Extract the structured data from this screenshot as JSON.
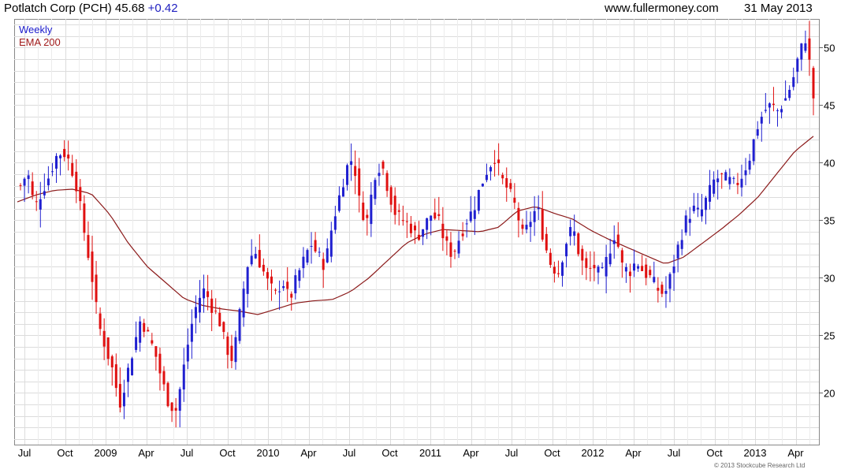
{
  "header": {
    "title": "Potlatch Corp (PCH) 45.68",
    "change": "+0.42",
    "site": "www.fullermoney.com",
    "date": "31 May 2013"
  },
  "legend": {
    "period": "Weekly",
    "ema": "EMA 200"
  },
  "copyright": "© 2013 Stockcube Research Ltd",
  "colors": {
    "up": "#2020d0",
    "down": "#e01010",
    "ema": "#8b1a1a",
    "grid": "#dcdcdc"
  },
  "chart_data": {
    "type": "candlestick",
    "title": "Potlatch Corp (PCH) 45.68 +0.42",
    "x_axis": {
      "tick_labels": [
        "Jul",
        "Oct",
        "2009",
        "Apr",
        "Jul",
        "Oct",
        "2010",
        "Apr",
        "Jul",
        "Oct",
        "2011",
        "Apr",
        "Jul",
        "Oct",
        "2012",
        "Apr",
        "Jul",
        "Oct",
        "2013",
        "Apr"
      ]
    },
    "y_axis": {
      "position": "right",
      "range": [
        15.5,
        52.5
      ],
      "ticks": [
        20,
        25,
        30,
        35,
        40,
        45,
        50
      ]
    },
    "grid": true,
    "legend": "top-left",
    "series": [
      {
        "name": "Weekly",
        "kind": "ohlc",
        "close_path": [
          38,
          39.2,
          36,
          37.5,
          38.8,
          40.5,
          41,
          40,
          37.8,
          34,
          30.5,
          26,
          24,
          22,
          19,
          21.5,
          24,
          26.5,
          25,
          23.5,
          21,
          19,
          18.5,
          22,
          25.5,
          28,
          29,
          27.5,
          26.5,
          24,
          22.8,
          27,
          31,
          32.5,
          31,
          29.5,
          28.5,
          29.8,
          28,
          30,
          31.5,
          33,
          32,
          31,
          34.5,
          37,
          39.5,
          40.5,
          36,
          35,
          39,
          40,
          37.5,
          35.5,
          35,
          34.5,
          33.5,
          34.5,
          35.5,
          35,
          33,
          32,
          33.5,
          35,
          36,
          38,
          39.5,
          40.5,
          38.5,
          37.5,
          36,
          33.5,
          35,
          36.2,
          33,
          31,
          30.5,
          33,
          34.5,
          31.8,
          30.5,
          31,
          30,
          32,
          34,
          31,
          30.5,
          31.5,
          30.5,
          30,
          29,
          28.5,
          30.5,
          33,
          35,
          36,
          35.5,
          37,
          38.5,
          38.8,
          38.5,
          38,
          39,
          40.5,
          43,
          44.5,
          45,
          44.5,
          45.5,
          47,
          49.5,
          51,
          45.68
        ]
      },
      {
        "name": "EMA 200",
        "kind": "line",
        "path": [
          36.6,
          37.2,
          37.6,
          37.7,
          37.3,
          35.5,
          33,
          31,
          29.6,
          28.2,
          27.6,
          27.3,
          27.1,
          26.8,
          27.3,
          27.8,
          28.0,
          28.1,
          28.8,
          30.0,
          31.5,
          33.0,
          33.8,
          34.2,
          34.1,
          34.0,
          34.4,
          35.8,
          36.2,
          35.6,
          35.1,
          34.1,
          33.3,
          32.6,
          31.9,
          31.2,
          31.8,
          33.0,
          34.2,
          35.5,
          37.0,
          39.0,
          41.0,
          42.3
        ]
      }
    ]
  }
}
